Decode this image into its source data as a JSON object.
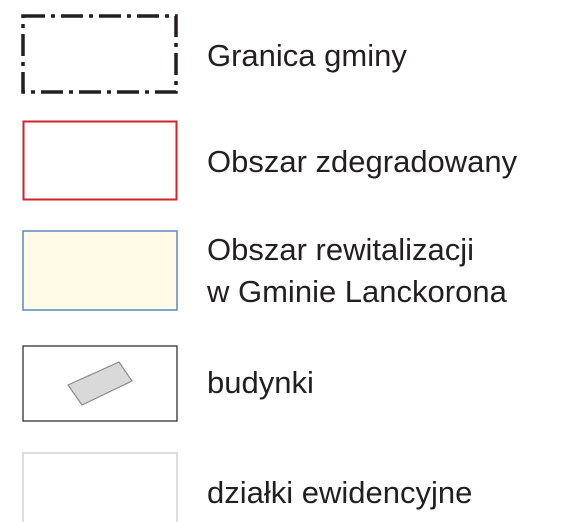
{
  "legend": {
    "items": [
      {
        "id": "municipality-boundary",
        "label": "Granica gminy",
        "symbol": "dash-dot-outline",
        "stroke": "#231f20",
        "fill": "#ffffff"
      },
      {
        "id": "degraded-area",
        "label": "Obszar zdegradowany",
        "symbol": "solid-outline",
        "stroke": "#d2232a",
        "fill": "#ffffff"
      },
      {
        "id": "revitalization-area",
        "label_line1": "Obszar rewitalizacji",
        "label_line2": "w Gminie Lanckorona",
        "symbol": "filled-rect",
        "stroke": "#5b87c5",
        "fill": "#fffbe6"
      },
      {
        "id": "buildings",
        "label": "budynki",
        "symbol": "building-rect",
        "stroke": "#231f20",
        "fill": "#ffffff",
        "building_fill": "#d9d9d9",
        "building_stroke": "#8c8c8c"
      },
      {
        "id": "parcels",
        "label": "działki ewidencyjne",
        "symbol": "thin-outline",
        "stroke": "#c8c8c8",
        "fill": "#ffffff"
      }
    ]
  }
}
